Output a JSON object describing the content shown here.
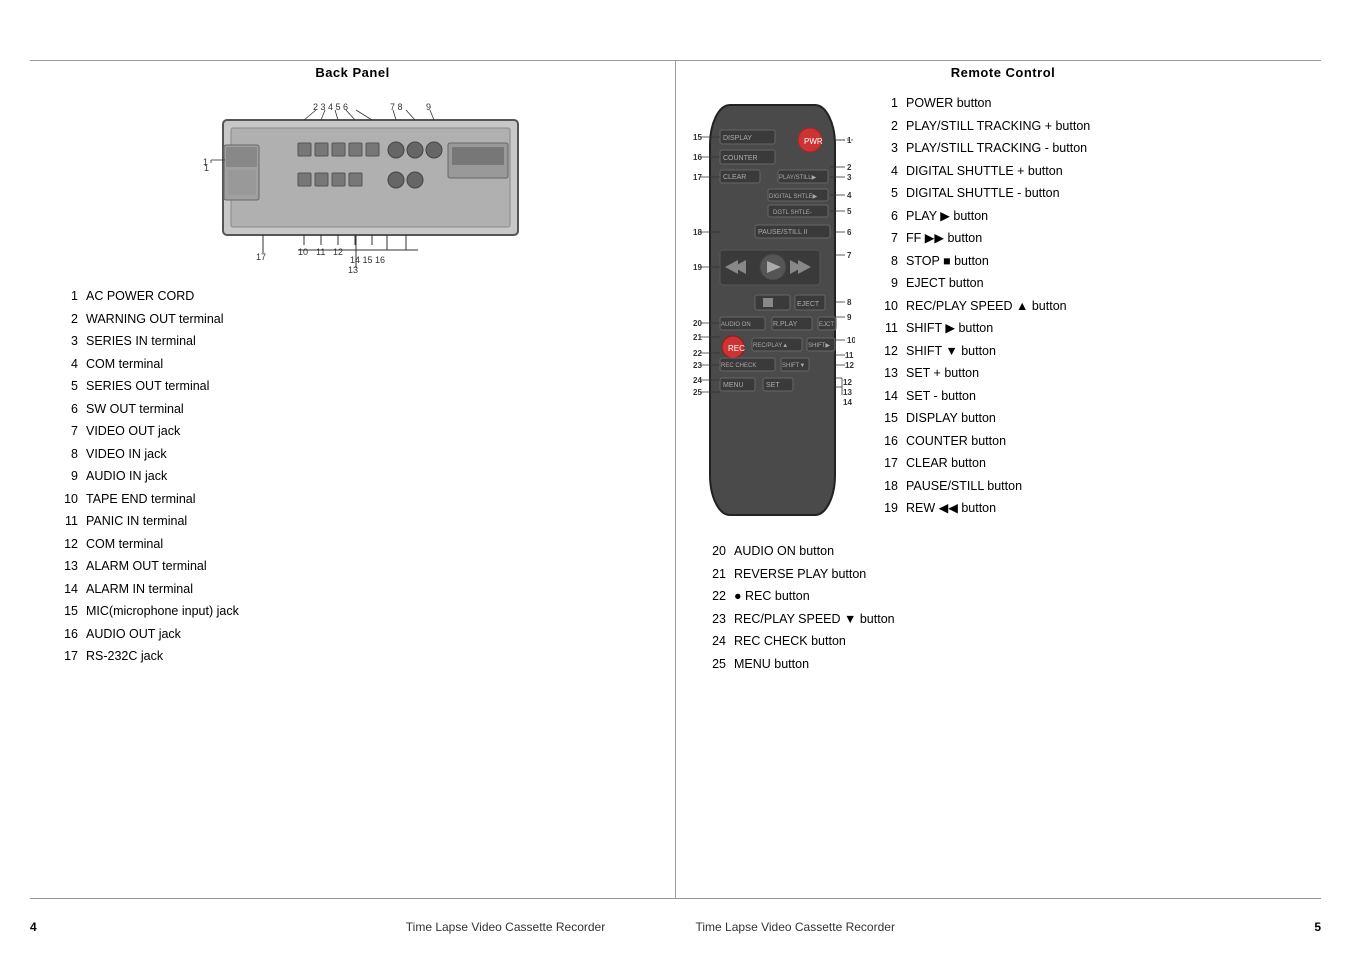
{
  "titles": {
    "left_panel": "Back Panel",
    "right_panel": "Remote Control"
  },
  "left_items": [
    {
      "num": "1",
      "text": "AC POWER CORD"
    },
    {
      "num": "2",
      "text": "WARNING OUT terminal"
    },
    {
      "num": "3",
      "text": "SERIES IN terminal"
    },
    {
      "num": "4",
      "text": "COM terminal"
    },
    {
      "num": "5",
      "text": "SERIES OUT terminal"
    },
    {
      "num": "6",
      "text": "SW OUT terminal"
    },
    {
      "num": "7",
      "text": "VIDEO OUT jack"
    },
    {
      "num": "8",
      "text": "VIDEO IN jack"
    },
    {
      "num": "9",
      "text": "AUDIO IN jack"
    },
    {
      "num": "10",
      "text": "TAPE END terminal"
    },
    {
      "num": "11",
      "text": "PANIC IN terminal"
    },
    {
      "num": "12",
      "text": "COM terminal"
    },
    {
      "num": "13",
      "text": "ALARM OUT terminal"
    },
    {
      "num": "14",
      "text": "ALARM IN terminal"
    },
    {
      "num": "15",
      "text": "MIC(microphone input) jack"
    },
    {
      "num": "16",
      "text": "AUDIO OUT jack"
    },
    {
      "num": "17",
      "text": "RS-232C jack"
    }
  ],
  "right_items_top": [
    {
      "num": "1",
      "text": "POWER button"
    },
    {
      "num": "2",
      "text": "PLAY/STILL TRACKING + button"
    },
    {
      "num": "3",
      "text": "PLAY/STILL TRACKING - button"
    },
    {
      "num": "4",
      "text": "DIGITAL SHUTTLE + button"
    },
    {
      "num": "5",
      "text": "DIGITAL SHUTTLE - button"
    },
    {
      "num": "6",
      "text": "PLAY ▶ button"
    },
    {
      "num": "7",
      "text": "FF ▶▶ button"
    },
    {
      "num": "8",
      "text": "STOP ■ button"
    },
    {
      "num": "9",
      "text": "EJECT button"
    },
    {
      "num": "10",
      "text": "REC/PLAY SPEED ▲ button"
    },
    {
      "num": "11",
      "text": "SHIFT ▶ button"
    },
    {
      "num": "12",
      "text": "SHIFT ▼ button"
    },
    {
      "num": "13",
      "text": "SET + button"
    },
    {
      "num": "14",
      "text": "SET - button"
    },
    {
      "num": "15",
      "text": "DISPLAY button"
    },
    {
      "num": "16",
      "text": "COUNTER button"
    },
    {
      "num": "17",
      "text": "CLEAR button"
    },
    {
      "num": "18",
      "text": "PAUSE/STILL  button"
    },
    {
      "num": "19",
      "text": "REW ◀◀ button"
    }
  ],
  "right_items_bottom": [
    {
      "num": "20",
      "text": "AUDIO ON button"
    },
    {
      "num": "21",
      "text": "REVERSE PLAY button"
    },
    {
      "num": "22",
      "text": "● REC button"
    },
    {
      "num": "23",
      "text": "REC/PLAY SPEED ▼ button"
    },
    {
      "num": "24",
      "text": "REC CHECK button"
    },
    {
      "num": "25",
      "text": "MENU button"
    }
  ],
  "footer": {
    "page_left": "4",
    "page_right": "5",
    "text_left": "Time Lapse Video Cassette Recorder",
    "text_right": "Time Lapse Video Cassette Recorder"
  }
}
